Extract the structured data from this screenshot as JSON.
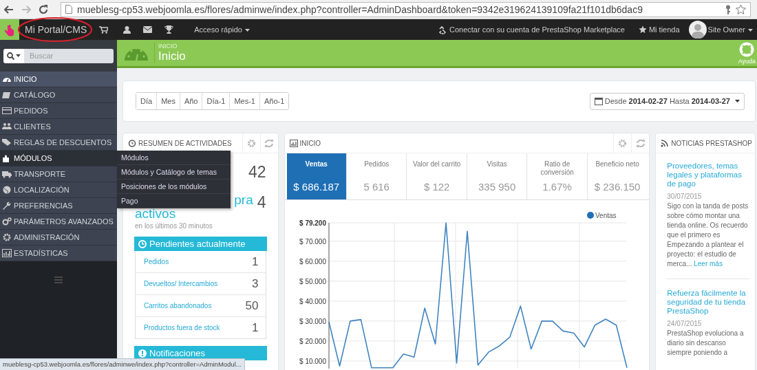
{
  "browser": {
    "url": "mueblesg-cp53.webjoomla.es/flores/adminwe/index.php?controller=AdminDashboard&token=9342e319624139109fa21f101db6dac9"
  },
  "top_nav": {
    "shop_name": "Mi Portal/CMS",
    "quick_access": "Acceso rápido",
    "marketplace_link": "Conectar con su cuenta de PrestaShop Marketplace",
    "my_shop": "Mi tienda",
    "user": "Site Owner"
  },
  "search": {
    "placeholder": "Buscar"
  },
  "page_header": {
    "breadcrumb": "INICIO",
    "title": "Inicio",
    "help": "Ayuda"
  },
  "sidebar": {
    "items": [
      {
        "label": "INICIO",
        "selected": true,
        "expanded": false
      },
      {
        "label": "CATÁLOGO",
        "selected": false,
        "expanded": false
      },
      {
        "label": "PEDIDOS",
        "selected": false,
        "expanded": false
      },
      {
        "label": "CLIENTES",
        "selected": false,
        "expanded": false
      },
      {
        "label": "REGLAS DE DESCUENTOS",
        "selected": false,
        "expanded": false
      },
      {
        "label": "MÓDULOS",
        "selected": false,
        "expanded": true,
        "children": [
          {
            "label": "Módulos"
          },
          {
            "label": "Módulos y Catálogo de temas"
          },
          {
            "label": "Posiciones de los módulos"
          },
          {
            "label": "Pago"
          }
        ]
      },
      {
        "label": "TRANSPORTE",
        "selected": false,
        "expanded": false
      },
      {
        "label": "LOCALIZACIÓN",
        "selected": false,
        "expanded": false
      },
      {
        "label": "PREFERENCIAS",
        "selected": false,
        "expanded": false
      },
      {
        "label": "PARÁMETROS AVANZADOS",
        "selected": false,
        "expanded": false
      },
      {
        "label": "ADMINISTRACIÓN",
        "selected": false,
        "expanded": false
      },
      {
        "label": "ESTADÍSTICAS",
        "selected": false,
        "expanded": false
      }
    ]
  },
  "period_buttons": [
    "Día",
    "Mes",
    "Año",
    "Día-1",
    "Mes-1",
    "Año-1"
  ],
  "date_range": "Desde **2014-02-27** Hasta **2014-03-27**",
  "activity_panel": {
    "title": "RESUMEN DE ACTIVIDADES",
    "online_visitors": {
      "value": "42"
    },
    "active_carts": {
      "label_lines": [
        "pra",
        "activos"
      ],
      "value": "4"
    },
    "subtitle": "en los últimos 30 minutos",
    "pending": {
      "title": "Pendientes actualmente",
      "rows": [
        {
          "label": "Pedidos",
          "value": "1"
        },
        {
          "label": "Devueltos/ Intercambios",
          "value": "3"
        },
        {
          "label": "Carritos abandonados",
          "value": "50"
        },
        {
          "label": "Productos fuera de stock",
          "value": "1"
        }
      ]
    },
    "notifications": {
      "title": "Notificaciones"
    }
  },
  "dashboard": {
    "title": "INICIO",
    "kpis": [
      {
        "label": "Ventas",
        "value": "$ 686.187",
        "selected": true
      },
      {
        "label": "Pedidos",
        "value": "5 616",
        "selected": false
      },
      {
        "label": "Valor del carrito",
        "value": "$ 122",
        "selected": false
      },
      {
        "label": "Visitas",
        "value": "335 950",
        "selected": false
      },
      {
        "label": "Ratio de conversión",
        "value": "1.67%",
        "selected": false
      },
      {
        "label": "Beneficio neto",
        "value": "$ 236.150",
        "selected": false
      }
    ],
    "chart_data": {
      "type": "line",
      "grid": true,
      "ylim": [
        0,
        79.2
      ],
      "yticks": [
        {
          "value": 10,
          "label": "$ 10.000"
        },
        {
          "value": 20,
          "label": "$ 20.000"
        },
        {
          "value": 30,
          "label": "$ 30.000"
        },
        {
          "value": 40,
          "label": "$ 40.000"
        },
        {
          "value": 50,
          "label": "$ 50.000"
        },
        {
          "value": 60,
          "label": "$ 60.000"
        },
        {
          "value": 70,
          "label": "$ 70.000"
        },
        {
          "value": 79.2,
          "label": "$ 79.200"
        }
      ],
      "series": [
        {
          "name": "Ventas",
          "color": "#1f6fb5",
          "values": [
            29.5,
            7.5,
            30,
            30.8,
            6.6,
            6.6,
            6.6,
            13.5,
            12,
            36.5,
            18.5,
            79.2,
            9,
            75,
            8,
            14.5,
            17.5,
            22,
            37.5,
            16,
            30,
            30,
            25,
            24,
            17,
            28,
            31,
            28,
            6.6
          ]
        }
      ]
    }
  },
  "news": {
    "title": "NOTICIAS PRESTASHOP",
    "items": [
      {
        "title": "Proveedores, temas legales y plataformas de pago",
        "date": "30/07/2015",
        "excerpt": "Sigo con la tanda de posts sobre cómo montar una tienda online. Os recuerdo que el primero es Empezando a plantear el proyecto: el estudio de merca...",
        "link": "Leer más"
      },
      {
        "title": "Refuerza fácilmente la seguridad de tu tienda PrestaShop",
        "date": "24/07/2015",
        "excerpt": "PrestaShop evoluciona a diario sin descanso siempre poniendo a"
      }
    ]
  },
  "status_bar": "mueblesg-cp53.webjoomla.es/flores/adminwe/index.php?controller=AdminModul..."
}
